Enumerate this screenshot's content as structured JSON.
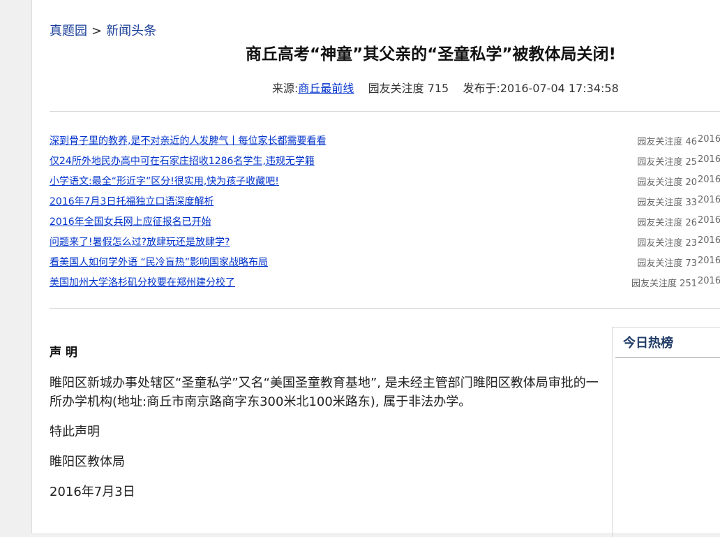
{
  "breadcrumb": {
    "home": "真题园",
    "separator": ">",
    "section": "新闻头条"
  },
  "article": {
    "title": "商丘高考“神童”其父亲的“圣童私学”被教体局关闭!",
    "source_label": "来源:",
    "source_name": "商丘最前线",
    "views_label": "园友关注度 715",
    "published": "发布于:2016-07-04 17:34:58"
  },
  "related": [
    {
      "title": "深到骨子里的教养,是不对亲近的人发脾气丨每位家长都需要看看",
      "views": "园友关注度 46",
      "date": "2016-"
    },
    {
      "title": "仅24所外地民办高中可在石家庄招收1286名学生,违规无学籍",
      "views": "园友关注度 25",
      "date": "2016-"
    },
    {
      "title": "小学语文:最全“形近字”区分!很实用,快为孩子收藏吧!",
      "views": "园友关注度 20",
      "date": "2016-"
    },
    {
      "title": "2016年7月3日托福独立口语深度解析",
      "views": "园友关注度 33",
      "date": "2016-"
    },
    {
      "title": "2016年全国女兵网上应征报名已开始",
      "views": "园友关注度 26",
      "date": "2016-"
    },
    {
      "title": "问题来了!暑假怎么过?放肆玩还是放肆学?",
      "views": "园友关注度 23",
      "date": "2016-"
    },
    {
      "title": "看美国人如何学外语 “民冷盲热”影响国家战略布局",
      "views": "园友关注度 73",
      "date": "2016-"
    },
    {
      "title": "美国加州大学洛杉矶分校要在郑州建分校了",
      "views": "园友关注度 251",
      "date": "2016-"
    }
  ],
  "declaration": {
    "heading": "声 明",
    "paragraph": "睢阳区新城办事处辖区“圣童私学”又名“美国圣童教育基地”, 是未经主管部门睢阳区教体局审批的一所办学机构(地址:商丘市南京路商字东300米北100米路东), 属于非法办学。",
    "closing": "特此声明",
    "signature": "睢阳区教体局",
    "date": "2016年7月3日"
  },
  "sidebar": {
    "title": "今日热榜"
  }
}
